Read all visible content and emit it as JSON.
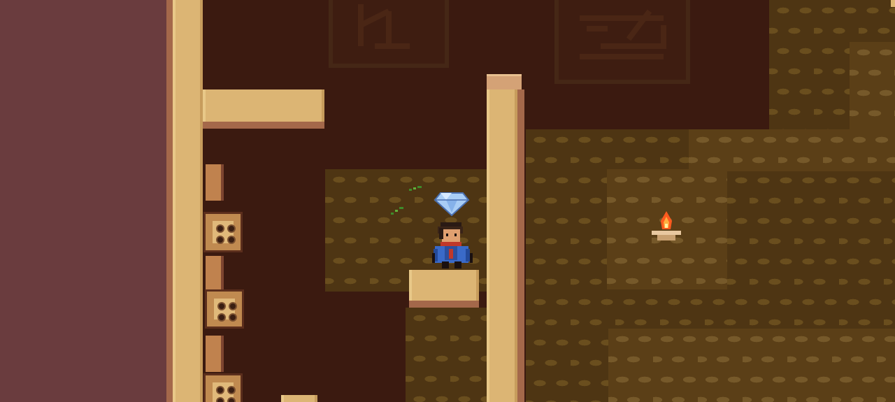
{
  "scene": {
    "name": "cave-temple-room",
    "colors": {
      "outer_wall": "#6a3c3e",
      "background": "#3b1a10",
      "sandstone": "#dcb574",
      "brick_dark": "#4e3513",
      "brick_light": "#5b3f17",
      "gem": "#a9cdf5",
      "flame": "#ff5a1e"
    },
    "sprites": {
      "player": "player-character-blue-cloak-red-scarf",
      "gem": "diamond-gem-icon",
      "torch": "wall-torch-icon",
      "sparkles": "green-sparkle-particles",
      "dice_blocks": [
        "dice-block",
        "dice-block",
        "dice-block"
      ]
    }
  }
}
